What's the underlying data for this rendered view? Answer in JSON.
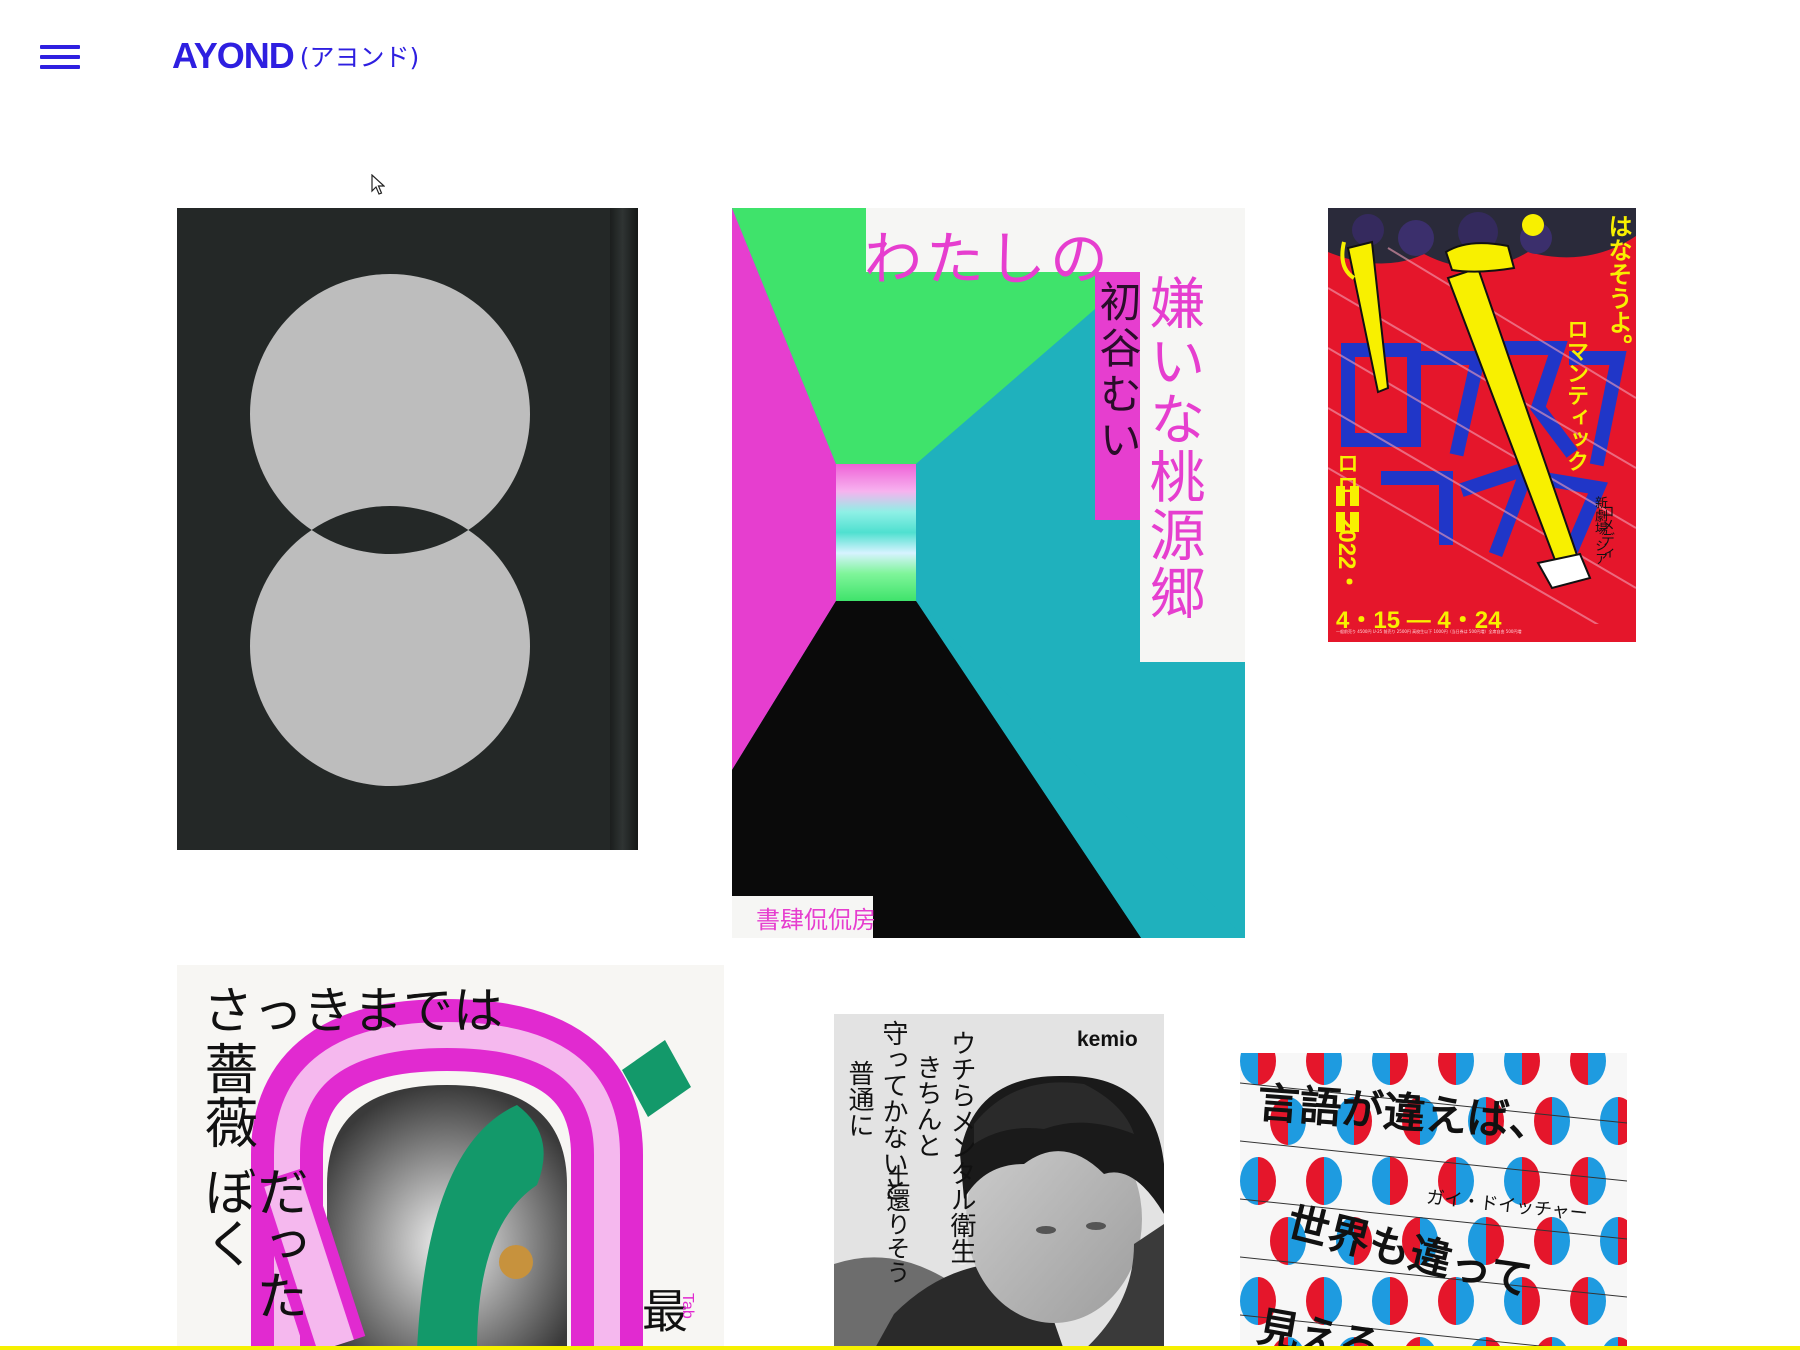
{
  "header": {
    "logo_main": "AYOND",
    "logo_sub": "(アヨンド)",
    "menu_icon": "hamburger-menu-icon"
  },
  "colors": {
    "brand": "#2e1fe0",
    "pink": "#e63ecf",
    "green": "#3fe36b",
    "teal": "#1fb1bd",
    "red": "#e5162b",
    "yellow": "#f8f000"
  },
  "works": [
    {
      "kind": "book",
      "text": {}
    },
    {
      "kind": "poster",
      "text": {
        "line1": "わたしの",
        "title_col": "嫌いな桃源郷",
        "author_col": "初谷むい",
        "publisher": "書肆侃侃房"
      }
    },
    {
      "kind": "poster",
      "text": {
        "tagline": "はなそうよ。",
        "title_a": "ロマンティック",
        "title_b": "コメディ",
        "year": "2022・",
        "dates": "4・15 — 4・24",
        "venue": "新劇場 シア",
        "marks": "ロロ",
        "smallprint": "一般前売り 4500円 U-25 前売り 2500円 高校生以下 1000円（当日券は 500円増）全席自由 500円増"
      }
    },
    {
      "kind": "book",
      "text": {
        "title_row": "さっきまでは",
        "title_col1": "薔薇",
        "title_col2": "だったぼく",
        "sub": "最",
        "sub_en": "Tab"
      }
    },
    {
      "kind": "book",
      "text": {
        "author": "kemio",
        "col1": "ウチらメンタル衛生",
        "col2": "きちんと",
        "col3": "守ってかないと",
        "col4": "普通に",
        "col5": "土還りそう"
      }
    },
    {
      "kind": "book",
      "text": {
        "line1": "言語が違えば、",
        "line2": "世界も違って",
        "line3": "見える",
        "author": "ガイ・ドイッチャー"
      }
    }
  ]
}
